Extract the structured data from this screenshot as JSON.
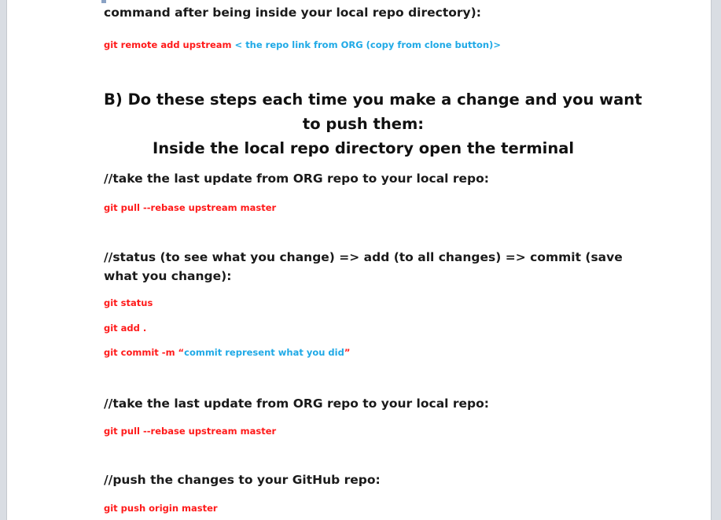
{
  "colors": {
    "command": "#ff1a1a",
    "placeholder": "#1fa9e6",
    "heading": "#1a1a1a"
  },
  "doc": {
    "line_intro": "command after being inside your local repo directory):",
    "remote_cmd": "git remote add upstream",
    "remote_arg": " < the repo link from ORG (copy from clone button)>",
    "section_b_title_1": "B) Do these steps each time you make a change and you want",
    "section_b_title_2": "to push them:",
    "section_b_title_3": "Inside the local repo directory open the terminal",
    "comment_pull_1": "//take the last update from ORG repo to your local repo:",
    "cmd_pull_1": "git pull --rebase upstream master",
    "comment_status_1": "//status (to see what you change) => add (to all changes) => commit (save",
    "comment_status_2": "what you change):",
    "cmd_status": "git status",
    "cmd_add": "git add .",
    "cmd_commit_prefix": "git commit -m “",
    "cmd_commit_msg": "commit represent what you did",
    "cmd_commit_suffix": "”",
    "comment_pull_2": "//take the last update from ORG repo to your local repo:",
    "cmd_pull_2": "git pull --rebase upstream master",
    "comment_push": "//push the changes to your GitHub repo:",
    "cmd_push": "git push origin master"
  }
}
